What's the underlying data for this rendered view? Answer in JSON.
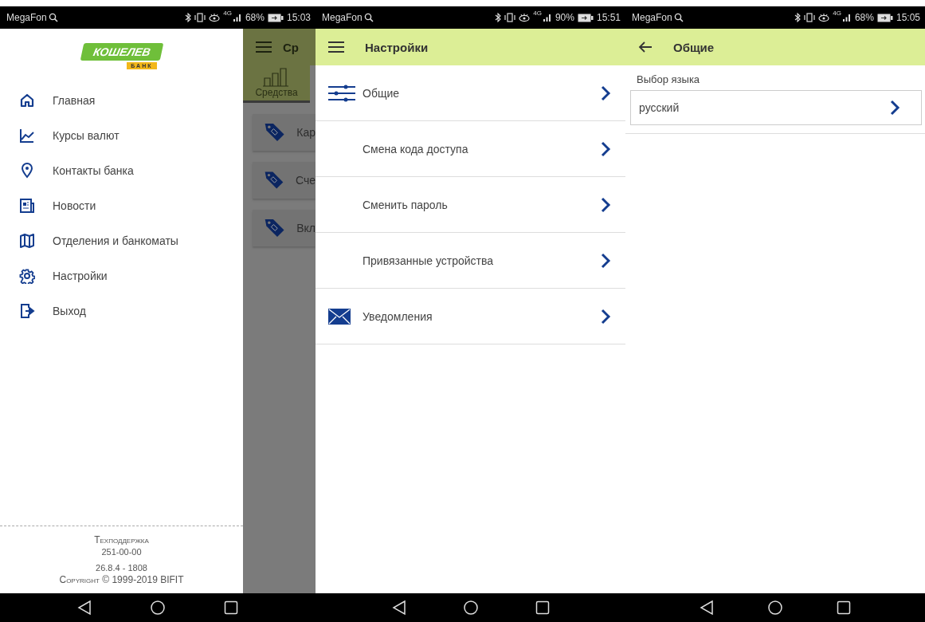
{
  "screen_1": {
    "status_bar": {
      "carrier": "MegaFon",
      "network": "4G",
      "battery": "68%",
      "time": "15:03"
    },
    "drawer": {
      "logo": {
        "name": "КОШЕЛЕВ",
        "sub": "БАНК"
      },
      "items": [
        {
          "kind": "home",
          "label": "Главная"
        },
        {
          "kind": "chart",
          "label": "Курсы валют"
        },
        {
          "kind": "pin",
          "label": "Контакты банка"
        },
        {
          "kind": "news",
          "label": "Новости"
        },
        {
          "kind": "map",
          "label": "Отделения и банкоматы"
        },
        {
          "kind": "gear",
          "label": "Настройки"
        },
        {
          "kind": "exit",
          "label": "Выход"
        }
      ],
      "footer": {
        "support_label": "Техподдержка",
        "support_phone": "251-00-00",
        "version": "26.8.4 - 1808",
        "copyright": "Copyright © 1999-2019 BIFIT"
      }
    },
    "behind": {
      "title": "Ср",
      "tab": "Средства",
      "cards": [
        "Кар",
        "Сче",
        "Вкл"
      ]
    }
  },
  "screen_2": {
    "status_bar": {
      "carrier": "MegaFon",
      "network": "4G",
      "battery": "90%",
      "time": "15:51"
    },
    "title": "Настройки",
    "rows": [
      {
        "kind": "sliders",
        "label": "Общие"
      },
      {
        "kind": "plain",
        "label": "Смена кода доступа"
      },
      {
        "kind": "plain",
        "label": "Сменить пароль"
      },
      {
        "kind": "plain",
        "label": "Привязанные устройства"
      },
      {
        "kind": "envelope",
        "label": "Уведомления"
      }
    ]
  },
  "screen_3": {
    "status_bar": {
      "carrier": "MegaFon",
      "network": "4G",
      "battery": "68%",
      "time": "15:05"
    },
    "title": "Общие",
    "field_label": "Выбор языка",
    "field_value": "русский"
  }
}
